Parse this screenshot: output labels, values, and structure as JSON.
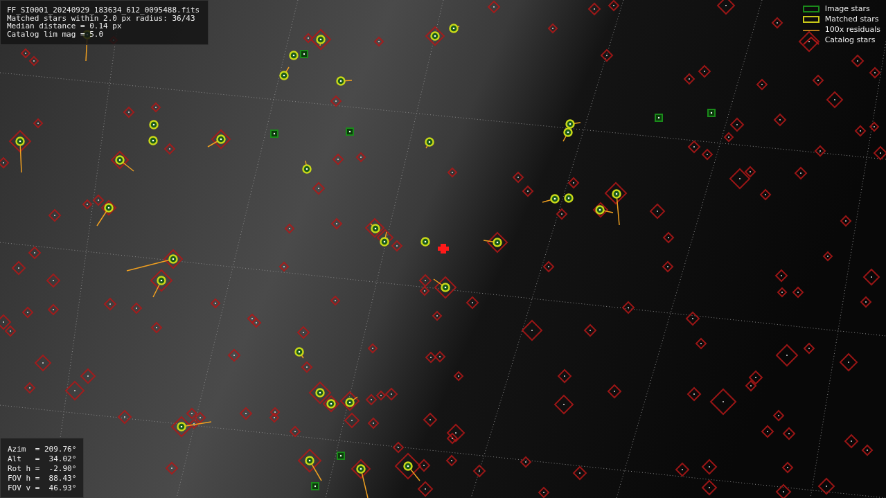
{
  "info_panel": {
    "lines": [
      "FF_SI0001_20240929_183634_612_0095488.fits",
      "Matched stars within 2.0 px radius: 36/43",
      "Median distance = 0.14 px",
      "Catalog lim mag = 5.0"
    ]
  },
  "legend": [
    {
      "kind": "image",
      "label": "Image stars"
    },
    {
      "kind": "matched",
      "label": "Matched stars"
    },
    {
      "kind": "residual",
      "label": "100x residuals"
    },
    {
      "kind": "catalog",
      "label": "Catalog stars"
    }
  ],
  "pointing_panel": {
    "lines": [
      "Azim  = 209.76°",
      "Alt   =  34.02°",
      "Rot h =  -2.90°",
      "FOV h =  88.43°",
      "FOV v =  46.93°"
    ]
  }
}
